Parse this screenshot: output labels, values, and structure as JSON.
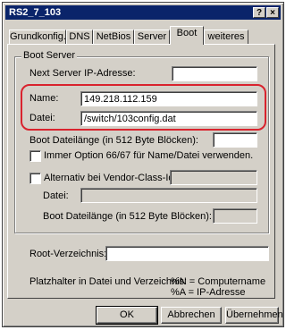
{
  "window": {
    "title": "RS2_7_103",
    "help_btn": "?",
    "close_btn": "×"
  },
  "tabs": [
    {
      "label": "Grundkonfig."
    },
    {
      "label": "DNS"
    },
    {
      "label": "NetBios"
    },
    {
      "label": "Server"
    },
    {
      "label": "Boot"
    },
    {
      "label": "weiteres"
    }
  ],
  "boot_server": {
    "group_label": "Boot Server",
    "next_server_label": "Next Server IP-Adresse:",
    "next_server_value": "",
    "name_label": "Name:",
    "name_value": "149.218.112.159",
    "datei_label": "Datei:",
    "datei_value": "/switch/103config.dat",
    "boot_len_label": "Boot Dateilänge (in 512 Byte Blöcken):",
    "boot_len_value": "",
    "option_label": "Immer Option 66/67 für Name/Datei verwenden.",
    "vendor_label": "Alternativ bei Vendor-Class-Id:",
    "vendor_value": "",
    "alt_datei_label": "Datei:",
    "alt_datei_value": "",
    "alt_boot_len_label": "Boot Dateilänge (in 512 Byte Blöcken):",
    "alt_boot_len_value": ""
  },
  "root": {
    "label": "Root-Verzeichnis:",
    "value": ""
  },
  "placeholder": {
    "label": "Platzhalter in Datei und Verzeichnis:",
    "line1": "%N = Computername",
    "line2": "%A = IP-Adresse"
  },
  "buttons": {
    "ok": "OK",
    "cancel": "Abbrechen",
    "apply": "Übernehmen"
  },
  "colors": {
    "highlight": "#d9232e",
    "titlebar": "#0a246a",
    "face": "#d4d0c8"
  }
}
